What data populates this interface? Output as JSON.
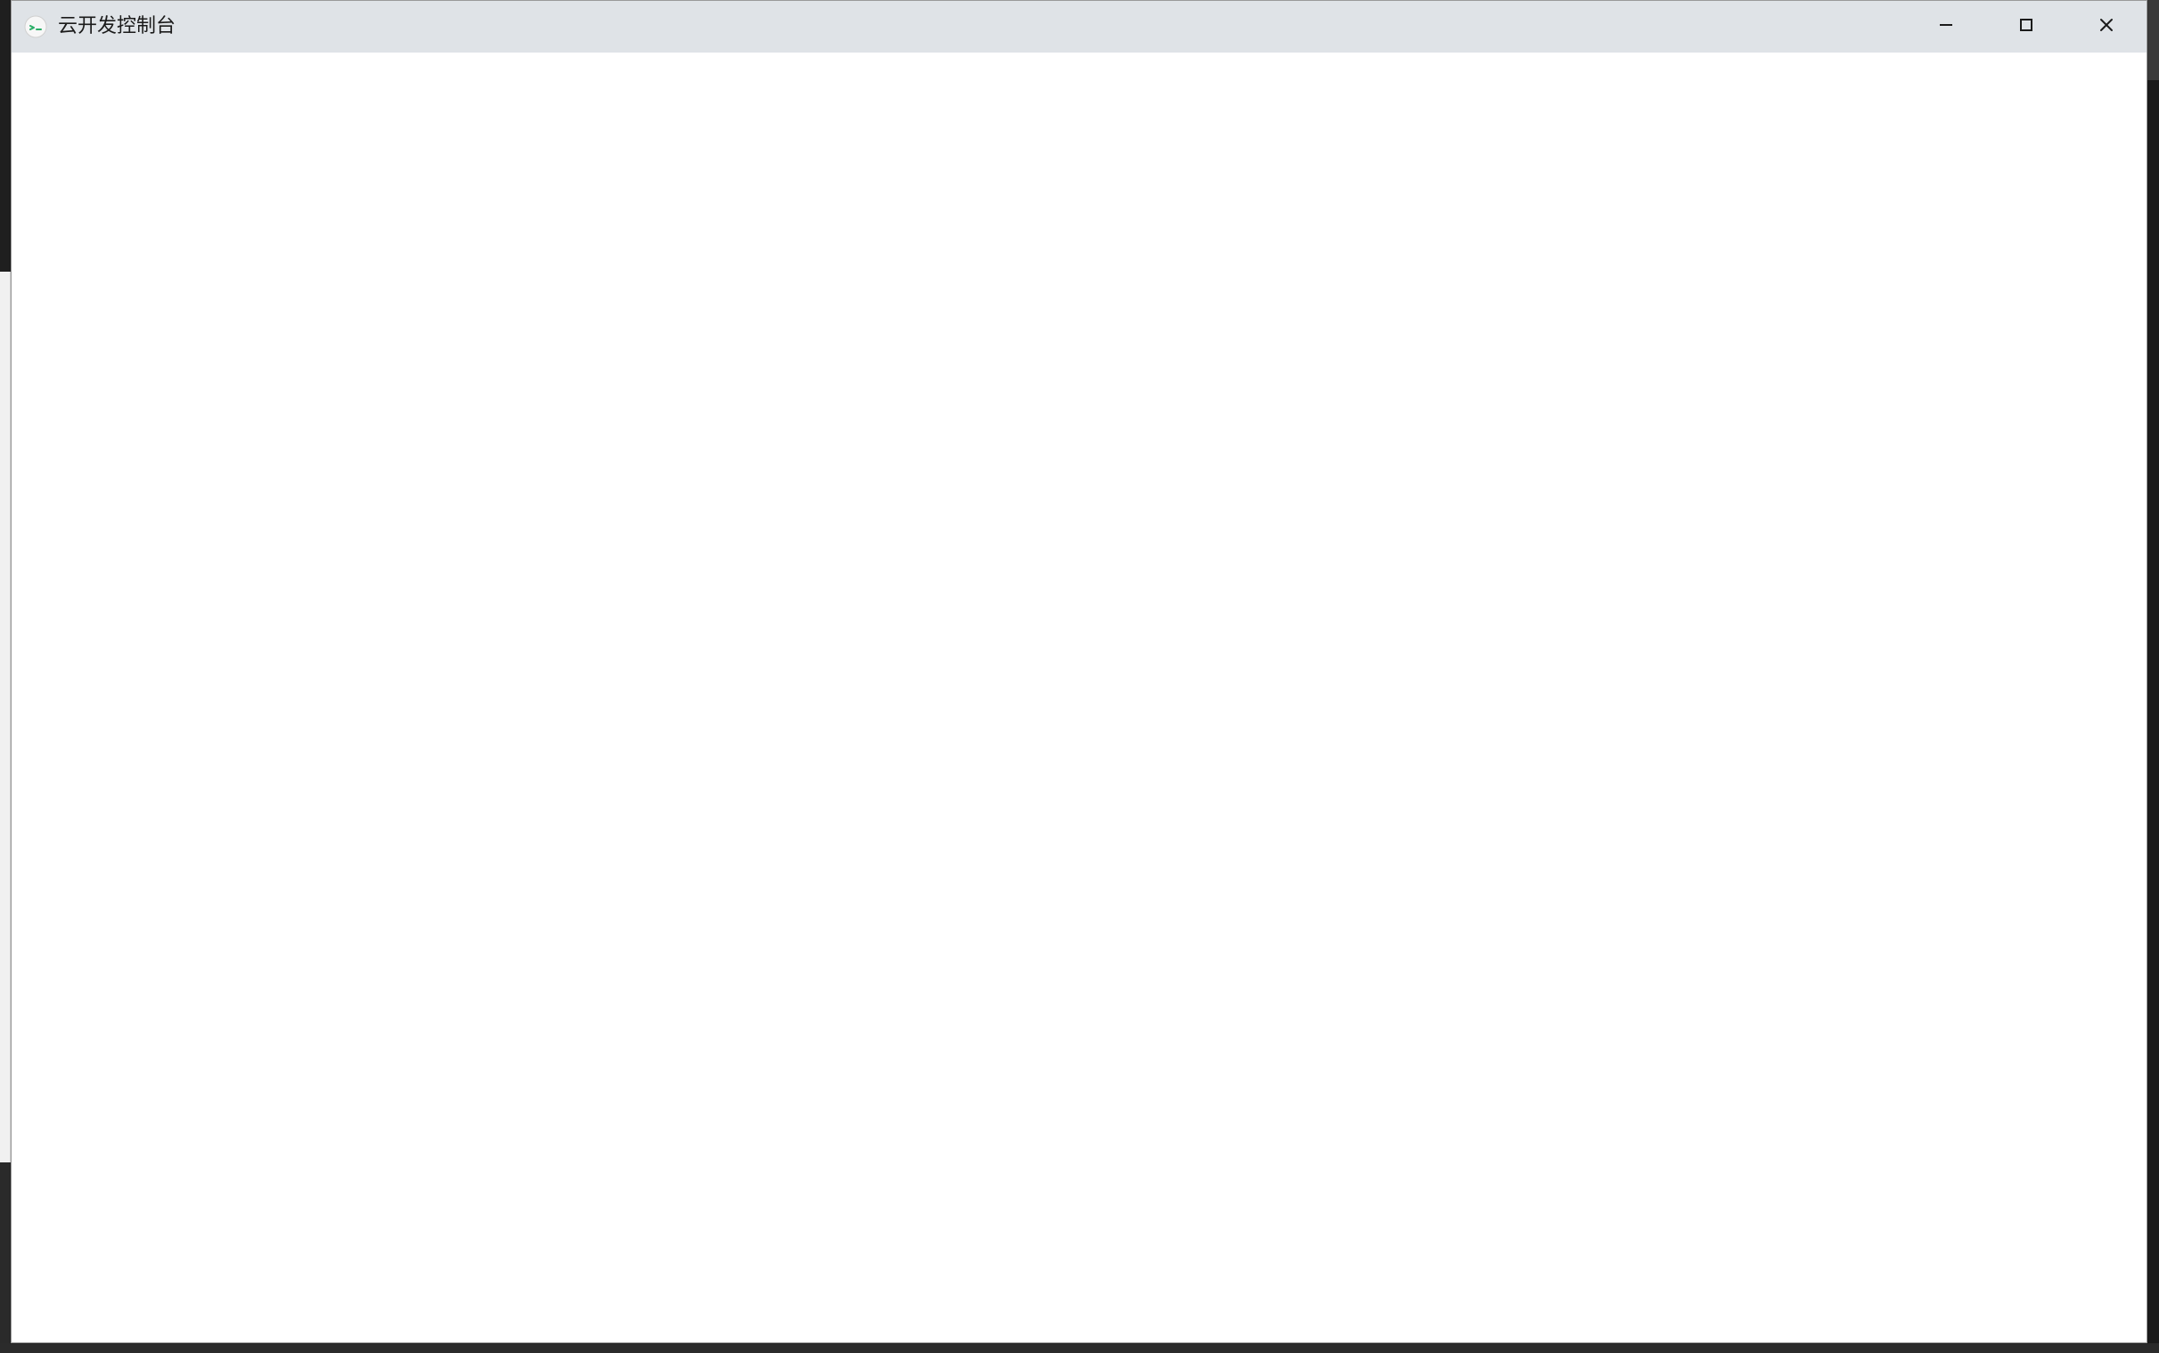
{
  "window": {
    "title": "云开发控制台",
    "controls": {
      "minimize_icon": "minimize-icon",
      "maximize_icon": "maximize-icon",
      "close_icon": "close-icon"
    }
  },
  "app_icon": {
    "name": "app-logo-icon",
    "accent": "#2aae67"
  }
}
